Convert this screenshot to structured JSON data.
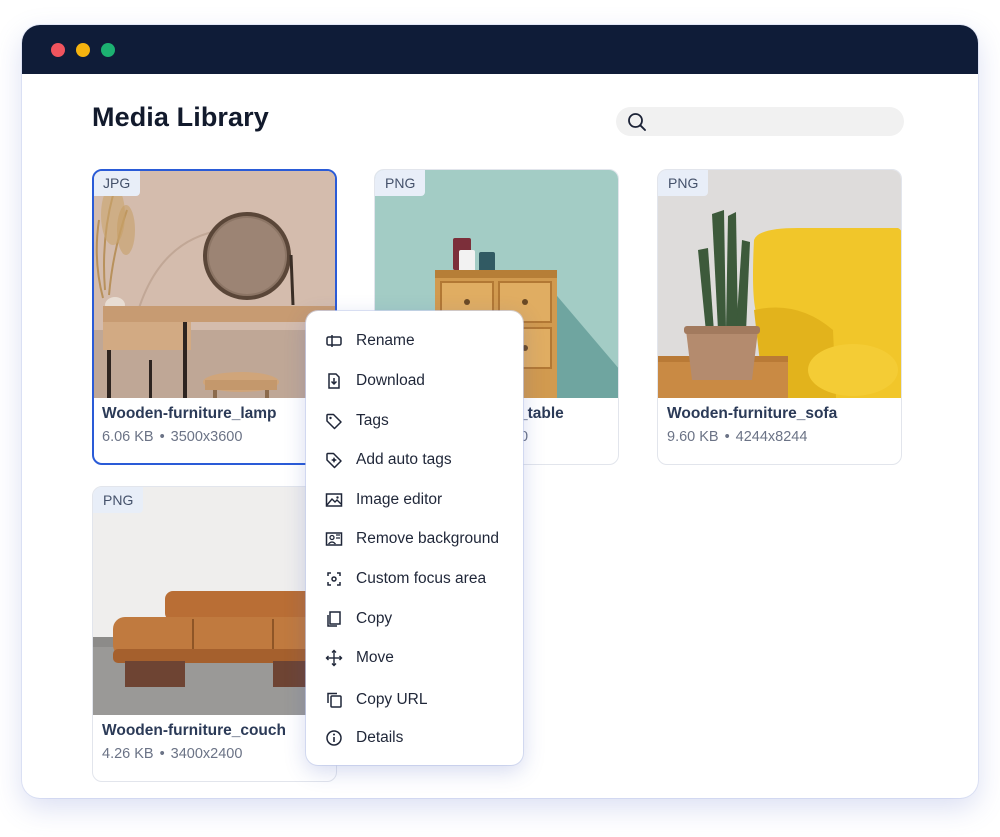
{
  "window": {
    "dots": {
      "red": "#f0545e",
      "yellow": "#f5b30f",
      "green": "#1cb171"
    },
    "titlebar_color": "#0f1c38"
  },
  "page": {
    "title": "Media Library"
  },
  "search": {
    "placeholder": "",
    "icon": "search-icon"
  },
  "accent_color": "#2a5bd7",
  "cards": [
    {
      "format": "JPG",
      "name": "Wooden-furniture_lamp",
      "size": "6.06 KB",
      "dimensions": "3500x3600",
      "selected": true
    },
    {
      "format": "PNG",
      "name": "Wooden-furniture_table",
      "name_visible": "_table",
      "size": "",
      "dimensions": "",
      "meta_visible": "0",
      "selected": false
    },
    {
      "format": "PNG",
      "name": "Wooden-furniture_sofa",
      "size": "9.60 KB",
      "dimensions": "4244x8244",
      "selected": false
    },
    {
      "format": "PNG",
      "name": "Wooden-furniture_couch",
      "size": "4.26 KB",
      "dimensions": "3400x2400",
      "selected": false
    }
  ],
  "meta_separator": "•",
  "context_menu": {
    "items": [
      {
        "label": "Rename",
        "icon": "rename-icon"
      },
      {
        "label": "Download",
        "icon": "download-icon"
      },
      {
        "label": "Tags",
        "icon": "tag-icon"
      },
      {
        "label": "Add auto tags",
        "icon": "auto-tag-icon"
      },
      {
        "label": "Image editor",
        "icon": "image-icon"
      },
      {
        "label": "Remove background",
        "icon": "remove-background-icon"
      },
      {
        "label": "Custom focus area",
        "icon": "focus-area-icon"
      },
      {
        "label": "Copy",
        "icon": "copy-icon"
      },
      {
        "label": "Move",
        "icon": "move-icon"
      },
      {
        "label": "Copy URL",
        "icon": "copy-url-icon"
      },
      {
        "label": "Details",
        "icon": "info-icon"
      }
    ]
  }
}
